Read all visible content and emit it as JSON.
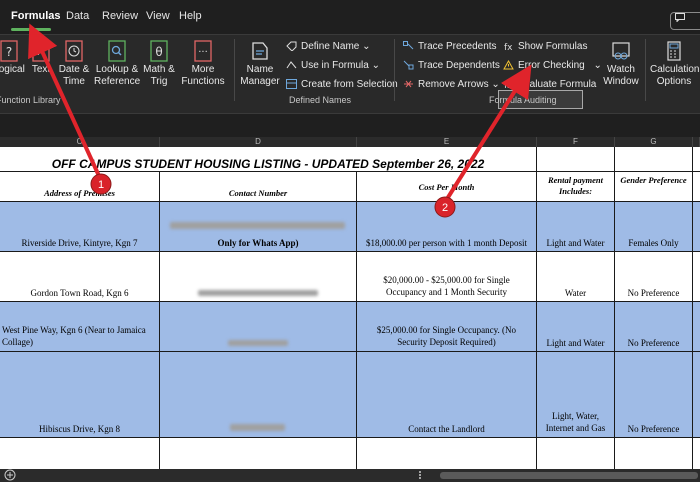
{
  "menu": [
    "Formulas",
    "Data",
    "Review",
    "View",
    "Help"
  ],
  "ribbon": {
    "function_library": {
      "buttons": [
        "Logical",
        "Text",
        "Date & Time",
        "Lookup & Reference",
        "Math & Trig",
        "More Functions"
      ],
      "label": "Function Library"
    },
    "defined_names": {
      "name_manager": "Name Manager",
      "define_name": "Define Name",
      "use_in_formula": "Use in Formula",
      "create_from_selection": "Create from Selection",
      "label": "Defined Names"
    },
    "formula_auditing": {
      "trace_precedents": "Trace Precedents",
      "trace_dependents": "Trace Dependents",
      "remove_arrows": "Remove Arrows",
      "show_formulas": "Show Formulas",
      "error_checking": "Error Checking",
      "evaluate_formula": "Evaluate Formula",
      "label": "Formula Auditing"
    },
    "watch_window": "Watch Window",
    "calculation_options": "Calculation Options"
  },
  "columns": [
    "C",
    "D",
    "E",
    "F",
    "G"
  ],
  "sheet": {
    "title": "OFF CAMPUS STUDENT HOUSING LISTING - UPDATED September 26, 2022",
    "headers": [
      "Address of Premises",
      "Contact Number",
      "Cost Per Month",
      "Rental payment Includes:",
      "Gender Preference"
    ],
    "rows": [
      {
        "address": "Riverside Drive, Kintyre, Kgn 7",
        "contact": "Only for Whats App)",
        "cost": "$18,000.00 per person with 1 month Deposit",
        "includes": "Light and Water",
        "gender": "Females Only"
      },
      {
        "address": "Gordon Town Road, Kgn 6",
        "contact": "",
        "cost": "$20,000.00 - $25,000.00 for Single Occupancy and 1 Month Security",
        "includes": "Water",
        "gender": "No Preference"
      },
      {
        "address": "West Pine Way, Kgn 6 (Near to Jamaica Collage)",
        "contact": "",
        "cost": "$25,000.00 for Single Occupancy. (No Security Deposit Required)",
        "includes": "Light and Water",
        "gender": "No Preference"
      },
      {
        "address": "Hibiscus Drive, Kgn 8",
        "contact": "",
        "cost": "Contact the Landlord",
        "includes": "Light, Water, Internet and Gas",
        "gender": "No Preference"
      }
    ]
  },
  "annotations": [
    "1",
    "2"
  ],
  "colors": {
    "arrow": "#e0242b",
    "row_blue": "#9fbbe6",
    "accent": "#5fb35f"
  }
}
